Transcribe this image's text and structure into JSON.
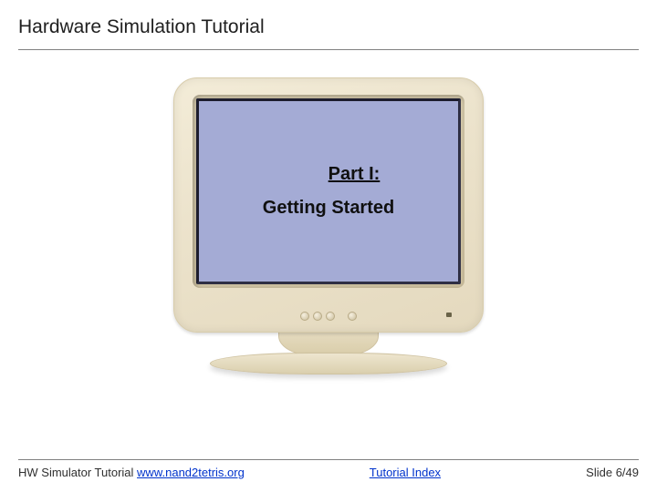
{
  "header": {
    "title": "Hardware Simulation Tutorial"
  },
  "screen": {
    "part_label": "Part I:",
    "part_subtitle": "Getting Started"
  },
  "footer": {
    "left_prefix": "HW Simulator Tutorial ",
    "left_link": "www.nand2tetris.org",
    "center_link": "Tutorial Index",
    "right": "Slide 6/49"
  }
}
